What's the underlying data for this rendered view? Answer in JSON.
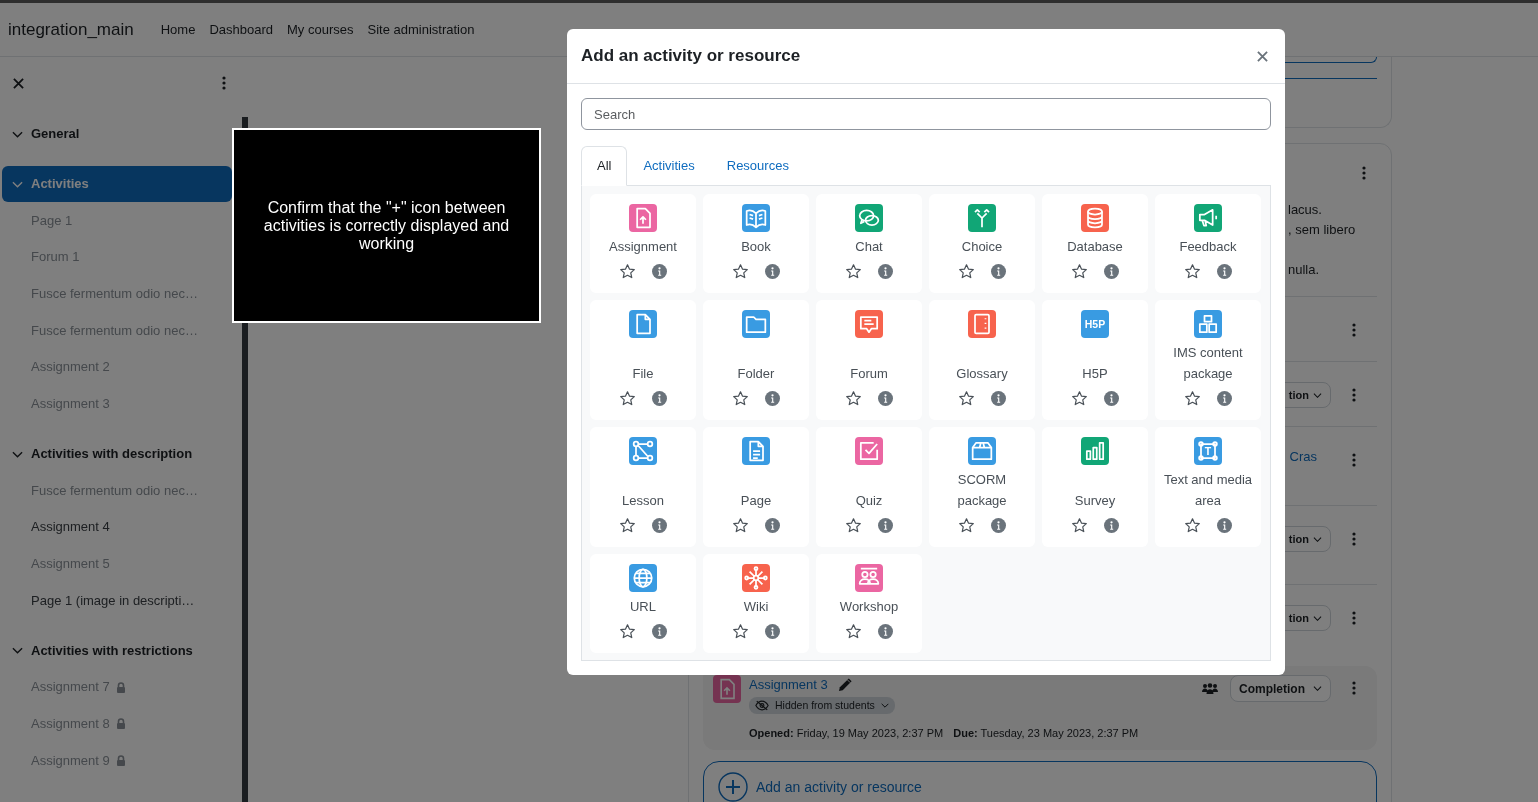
{
  "navbar": {
    "brand": "integration_main",
    "links": [
      {
        "label": "Home"
      },
      {
        "label": "Dashboard"
      },
      {
        "label": "My courses"
      },
      {
        "label": "Site administration"
      }
    ]
  },
  "course_index": {
    "sections": [
      {
        "title": "General",
        "expanded": true,
        "selected": false
      },
      {
        "title": "Activities",
        "expanded": true,
        "selected": true,
        "items": [
          {
            "name": "Page 1",
            "dimmed": true,
            "restricted": false
          },
          {
            "name": "Forum 1",
            "dimmed": true,
            "restricted": false
          },
          {
            "name": "Fusce fermentum odio nec…",
            "dimmed": true,
            "restricted": false
          },
          {
            "name": "Fusce fermentum odio nec…",
            "dimmed": true,
            "restricted": false
          },
          {
            "name": "Assignment 2",
            "dimmed": true,
            "restricted": false
          },
          {
            "name": "Assignment 3",
            "dimmed": true,
            "restricted": false
          }
        ]
      },
      {
        "title": "Activities with description",
        "expanded": true,
        "selected": false,
        "items": [
          {
            "name": "Fusce fermentum odio nec…",
            "dimmed": true,
            "restricted": false
          },
          {
            "name": "Assignment 4",
            "dimmed": false,
            "restricted": false
          },
          {
            "name": "Assignment 5",
            "dimmed": true,
            "restricted": false
          },
          {
            "name": "Page 1 (image in descripti…",
            "dimmed": false,
            "restricted": false
          }
        ]
      },
      {
        "title": "Activities with restrictions",
        "expanded": true,
        "selected": false,
        "items": [
          {
            "name": "Assignment 7",
            "dimmed": true,
            "restricted": true
          },
          {
            "name": "Assignment 8",
            "dimmed": true,
            "restricted": true
          },
          {
            "name": "Assignment 9",
            "dimmed": true,
            "restricted": true
          }
        ]
      }
    ]
  },
  "course_content": {
    "description_paragraphs": [
      [
        "lacus.",
        ", sem libero"
      ],
      [
        "nulla."
      ]
    ],
    "rows": [
      {
        "kind": "plain"
      },
      {
        "kind": "completion",
        "text": "tion"
      },
      {
        "kind": "link",
        "text": "Cras"
      },
      {
        "kind": "completion",
        "text": "tion"
      },
      {
        "kind": "completion",
        "text": "tion"
      }
    ],
    "highlighted_activity": {
      "name": "Assignment 3",
      "badge": "Hidden from students",
      "opened": "**Opened:** Friday, 19 May 2023, 2:37 PM",
      "due": "**Due:** Tuesday, 23 May 2023, 2:37 PM",
      "completion": "Completion"
    },
    "add_button": "Add an activity or resource"
  },
  "modal": {
    "title": "Add an activity or resource",
    "search_placeholder": "Search",
    "tabs": [
      {
        "label": "All",
        "selected": true
      },
      {
        "label": "Activities",
        "selected": false
      },
      {
        "label": "Resources",
        "selected": false
      }
    ],
    "items": [
      {
        "name": "Assignment",
        "color": "#eb66a2",
        "starred": false
      },
      {
        "name": "Book",
        "color": "#399be2",
        "starred": false
      },
      {
        "name": "Chat",
        "color": "#11a676",
        "starred": false
      },
      {
        "name": "Choice",
        "color": "#11a676",
        "starred": false
      },
      {
        "name": "Database",
        "color": "#f7634d",
        "starred": false
      },
      {
        "name": "Feedback",
        "color": "#11a676",
        "starred": false
      },
      {
        "name": "File",
        "color": "#399be2",
        "starred": false
      },
      {
        "name": "Folder",
        "color": "#399be2",
        "starred": false
      },
      {
        "name": "Forum",
        "color": "#f7634d",
        "starred": false
      },
      {
        "name": "Glossary",
        "color": "#f7634d",
        "starred": false
      },
      {
        "name": "H5P",
        "color": "#399be2",
        "starred": false,
        "icon_label": "H5P"
      },
      {
        "name": "IMS content package",
        "color": "#399be2",
        "starred": false
      },
      {
        "name": "Lesson",
        "color": "#399be2",
        "starred": false
      },
      {
        "name": "Page",
        "color": "#399be2",
        "starred": false
      },
      {
        "name": "Quiz",
        "color": "#eb66a2",
        "starred": false
      },
      {
        "name": "SCORM package",
        "color": "#399be2",
        "starred": false
      },
      {
        "name": "Survey",
        "color": "#11a676",
        "starred": false
      },
      {
        "name": "Text and media area",
        "color": "#399be2",
        "starred": false,
        "icon_label": "T"
      },
      {
        "name": "URL",
        "color": "#399be2",
        "starred": false
      },
      {
        "name": "Wiki",
        "color": "#f7634d",
        "starred": false
      },
      {
        "name": "Workshop",
        "color": "#eb66a2",
        "starred": false
      }
    ]
  },
  "instruction": {
    "text": "Confirm that the \"+\" icon between activities is correctly displayed and working"
  }
}
